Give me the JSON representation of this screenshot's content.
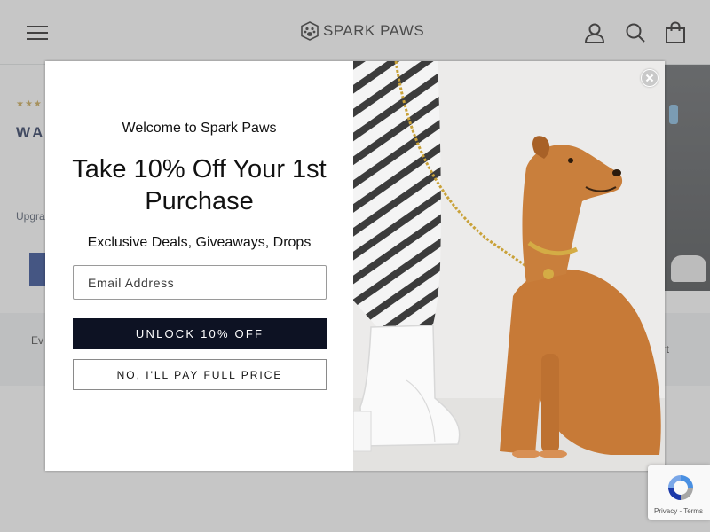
{
  "header": {
    "brand": "SPARK PAWS",
    "menu_icon": "hamburger-menu-icon",
    "account_icon": "account-icon",
    "search_icon": "search-icon",
    "cart_icon": "shopping-bag-icon"
  },
  "background_page": {
    "title_fragment": "WA",
    "upgrade_fragment": "Upgra",
    "band_left_fragment": "Ev",
    "band_right_fragment": "ort",
    "rating_stars": "★★★"
  },
  "popup": {
    "welcome": "Welcome to Spark Paws",
    "headline": "Take 10% Off Your 1st Purchase",
    "subline": "Exclusive Deals, Giveaways, Drops",
    "email_placeholder": "Email Address",
    "email_value": "",
    "unlock_label": "UNLOCK 10% OFF",
    "decline_label": "NO, I'LL PAY FULL PRICE",
    "close_icon": "close-icon",
    "image_subject": "dog-on-gold-chain-leash-photo"
  },
  "recaptcha": {
    "links": "Privacy - Terms",
    "icon": "recaptcha-icon"
  },
  "colors": {
    "unlock_bg": "#0d1223",
    "brand_navy": "#1b2a52",
    "rating_gold": "#c8a44a"
  }
}
